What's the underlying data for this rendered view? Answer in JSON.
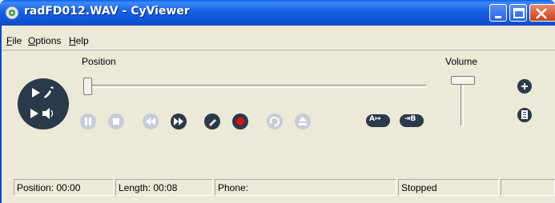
{
  "window": {
    "title": "radFD012.WAV - CyViewer",
    "colors": {
      "titlebar": "#0f54d6",
      "face": "#ece9d8",
      "record": "#e01010"
    }
  },
  "menu": {
    "items": [
      {
        "accel": "F",
        "rest": "ile"
      },
      {
        "accel": "O",
        "rest": "ptions"
      },
      {
        "accel": "H",
        "rest": "elp"
      }
    ]
  },
  "main": {
    "position_label": "Position",
    "volume_label": "Volume",
    "position_value": 0,
    "volume_value": 1,
    "ab_a_label": "A↦",
    "ab_b_label": "⇥B"
  },
  "icons": {
    "call": "phone-call-icon",
    "speaker": "speaker-icon",
    "pause": "pause-icon",
    "stop": "stop-icon",
    "rewind": "rewind-icon",
    "forward": "fast-forward-icon",
    "edit": "edit-icon",
    "record": "record-icon",
    "loop": "loop-icon",
    "eject": "eject-icon",
    "add": "add-icon",
    "doc": "document-icon"
  },
  "status": {
    "position": "Position: 00:00",
    "length": "Length: 00:08",
    "phone": "Phone:",
    "state": "Stopped",
    "extra": ""
  }
}
